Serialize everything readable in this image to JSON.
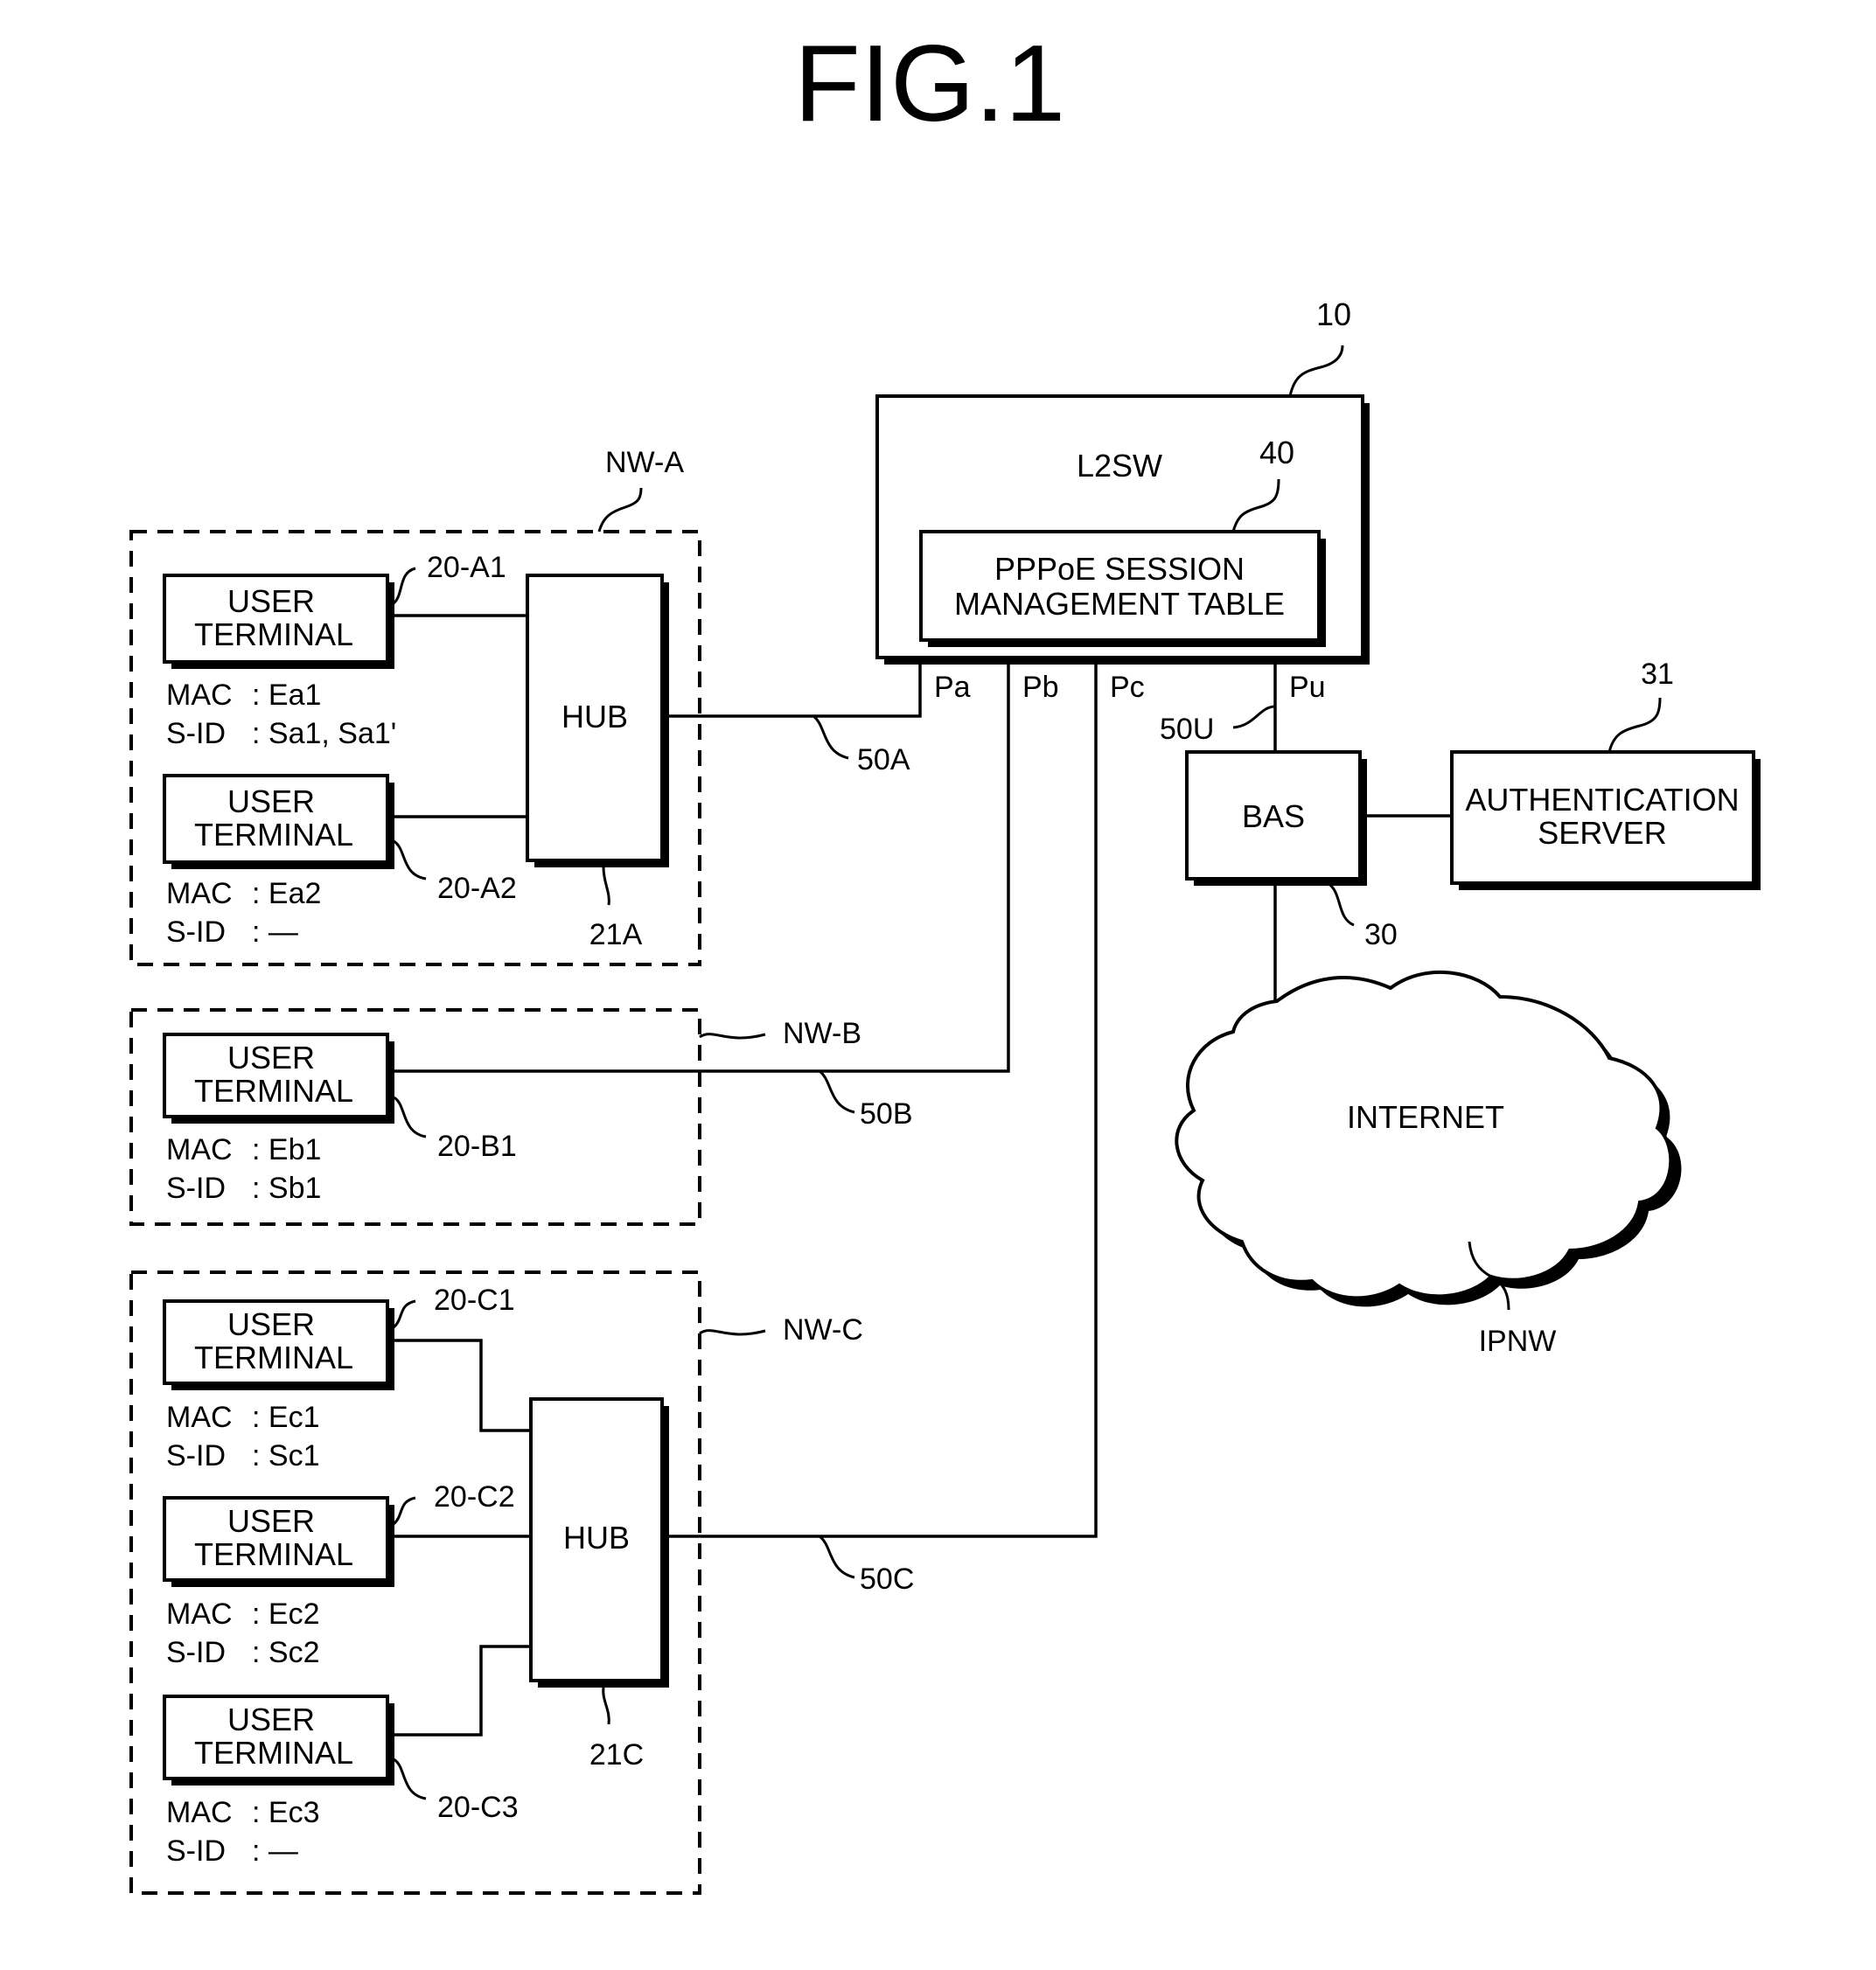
{
  "figure": {
    "title": "FIG.1"
  },
  "l2sw": {
    "ref": "10",
    "label": "L2SW",
    "table": {
      "ref": "40",
      "line1": "PPPoE SESSION",
      "line2": "MANAGEMENT TABLE"
    },
    "ports": [
      {
        "id": "Pa",
        "label": "Pa"
      },
      {
        "id": "Pb",
        "label": "Pb"
      },
      {
        "id": "Pc",
        "label": "Pc"
      },
      {
        "id": "Pu",
        "label": "Pu"
      }
    ]
  },
  "links": {
    "a": "50A",
    "b": "50B",
    "c": "50C",
    "u": "50U"
  },
  "bas": {
    "ref": "30",
    "label": "BAS"
  },
  "auth_server": {
    "ref": "31",
    "line1": "AUTHENTICATION",
    "line2": "SERVER"
  },
  "internet": {
    "label": "INTERNET",
    "ref": "IPNW"
  },
  "networks": {
    "a": {
      "label": "NW-A",
      "hub": {
        "label": "HUB",
        "ref": "21A"
      },
      "terminals": [
        {
          "ref": "20-A1",
          "line1": "USER",
          "line2": "TERMINAL",
          "mac_key": "MAC",
          "mac": ": Ea1",
          "sid_key": "S-ID",
          "sid": ": Sa1, Sa1'"
        },
        {
          "ref": "20-A2",
          "line1": "USER",
          "line2": "TERMINAL",
          "mac_key": "MAC",
          "mac": ": Ea2",
          "sid_key": "S-ID",
          "sid": ": —"
        }
      ]
    },
    "b": {
      "label": "NW-B",
      "terminals": [
        {
          "ref": "20-B1",
          "line1": "USER",
          "line2": "TERMINAL",
          "mac_key": "MAC",
          "mac": ": Eb1",
          "sid_key": "S-ID",
          "sid": ": Sb1"
        }
      ]
    },
    "c": {
      "label": "NW-C",
      "hub": {
        "label": "HUB",
        "ref": "21C"
      },
      "terminals": [
        {
          "ref": "20-C1",
          "line1": "USER",
          "line2": "TERMINAL",
          "mac_key": "MAC",
          "mac": ": Ec1",
          "sid_key": "S-ID",
          "sid": ": Sc1"
        },
        {
          "ref": "20-C2",
          "line1": "USER",
          "line2": "TERMINAL",
          "mac_key": "MAC",
          "mac": ": Ec2",
          "sid_key": "S-ID",
          "sid": ": Sc2"
        },
        {
          "ref": "20-C3",
          "line1": "USER",
          "line2": "TERMINAL",
          "mac_key": "MAC",
          "mac": ": Ec3",
          "sid_key": "S-ID",
          "sid": ": —"
        }
      ]
    }
  }
}
